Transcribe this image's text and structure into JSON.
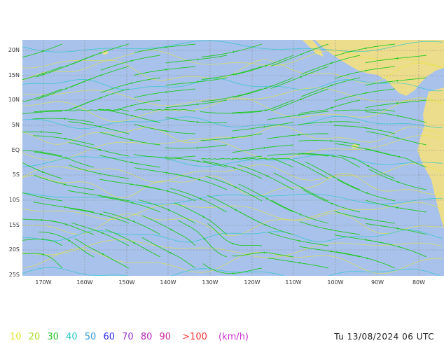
{
  "map": {
    "lat_labels": [
      "20N",
      "15N",
      "10N",
      "5N",
      "EQ",
      "5S",
      "10S",
      "15S",
      "20S",
      "25S"
    ],
    "lon_labels": [
      "170W",
      "160W",
      "150W",
      "140W",
      "130W",
      "120W",
      "110W",
      "100W",
      "90W",
      "80W"
    ],
    "colors": {
      "ocean": "#a8c2ec",
      "land": "#ecdd8c",
      "grid": "#8a8a8a",
      "streamline": "#22c822",
      "isotach_yellow": "#e6e63c",
      "isotach_cyan": "#1ec8c8"
    }
  },
  "legend": {
    "speeds": [
      {
        "label": "10",
        "color": "#e2e22c"
      },
      {
        "label": "20",
        "color": "#a8dc28"
      },
      {
        "label": "30",
        "color": "#28c828"
      },
      {
        "label": "40",
        "color": "#28c8c8"
      },
      {
        "label": "50",
        "color": "#3296dc"
      },
      {
        "label": "60",
        "color": "#3232e6"
      },
      {
        "label": "70",
        "color": "#9632c8"
      },
      {
        "label": "80",
        "color": "#b428b4"
      },
      {
        "label": "90",
        "color": "#c828a0"
      },
      {
        "label": ">100",
        "color": "#f03232"
      }
    ],
    "unit": "(km/h)",
    "unit_color": "#c832c8"
  },
  "timestamp": "Tu 13/08/2024 06 UTC"
}
